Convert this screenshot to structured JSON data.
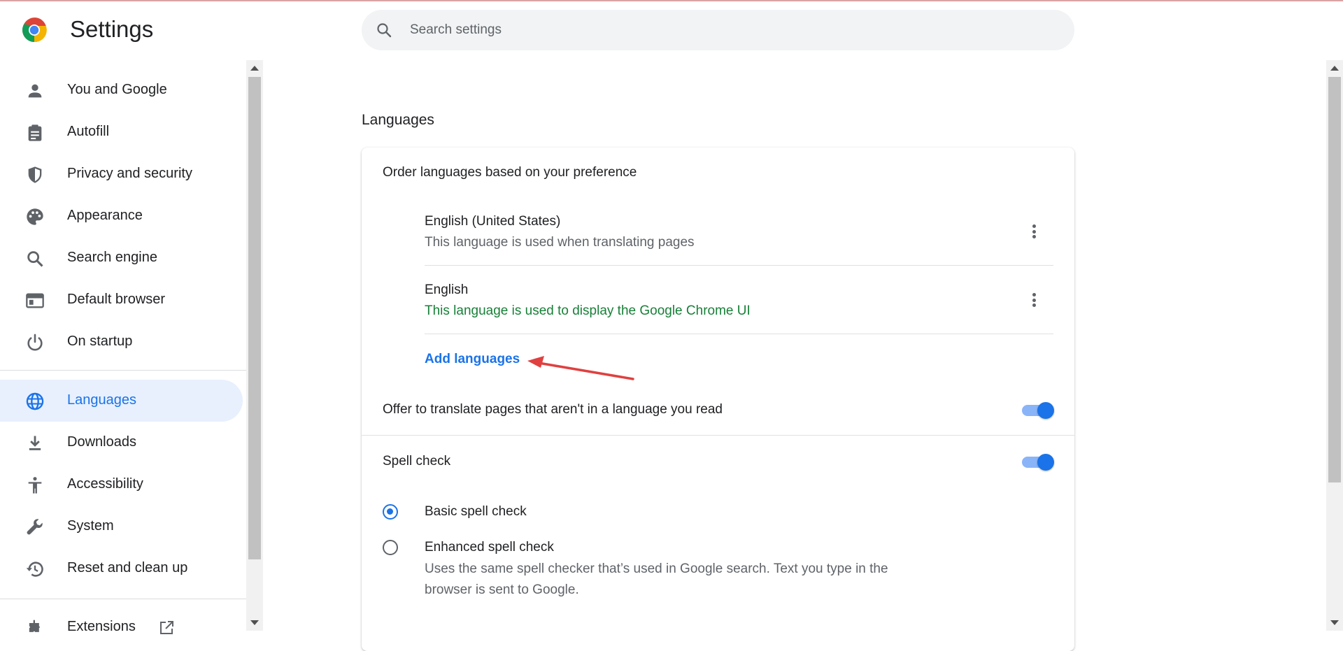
{
  "header": {
    "title": "Settings",
    "search_placeholder": "Search settings"
  },
  "sidebar": {
    "items": [
      {
        "label": "You and Google",
        "icon": "person-icon"
      },
      {
        "label": "Autofill",
        "icon": "clipboard-icon"
      },
      {
        "label": "Privacy and security",
        "icon": "shield-icon"
      },
      {
        "label": "Appearance",
        "icon": "palette-icon"
      },
      {
        "label": "Search engine",
        "icon": "search-icon"
      },
      {
        "label": "Default browser",
        "icon": "browser-window-icon"
      },
      {
        "label": "On startup",
        "icon": "power-icon"
      },
      {
        "label": "Languages",
        "icon": "globe-icon",
        "active": true
      },
      {
        "label": "Downloads",
        "icon": "download-icon"
      },
      {
        "label": "Accessibility",
        "icon": "accessibility-icon"
      },
      {
        "label": "System",
        "icon": "wrench-icon"
      },
      {
        "label": "Reset and clean up",
        "icon": "history-icon"
      },
      {
        "label": "Extensions",
        "icon": "puzzle-icon"
      }
    ]
  },
  "main": {
    "section_title": "Languages",
    "order_heading": "Order languages based on your preference",
    "languages": [
      {
        "name": "English (United States)",
        "description": "This language is used when translating pages"
      },
      {
        "name": "English",
        "description": "This language is used to display the Google Chrome UI"
      }
    ],
    "add_languages": "Add languages",
    "offer_translate": {
      "label": "Offer to translate pages that aren't in a language you read",
      "enabled": true
    },
    "spell_check": {
      "label": "Spell check",
      "enabled": true,
      "options": [
        {
          "label": "Basic spell check",
          "checked": true,
          "description": ""
        },
        {
          "label": "Enhanced spell check",
          "checked": false,
          "description_line1": "Uses the same spell checker that’s used in Google search. Text you type in the",
          "description_line2": "browser is sent to Google."
        }
      ]
    }
  },
  "colors": {
    "accent": "#1a73e8",
    "active_bg": "#e8f0fe",
    "green_text": "#188038",
    "annotation_arrow": "#e04040"
  }
}
